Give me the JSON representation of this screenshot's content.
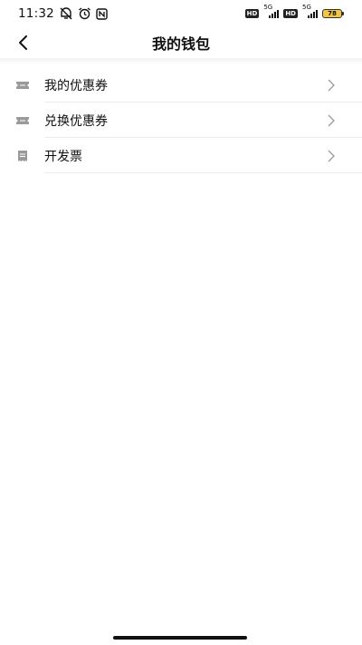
{
  "status_bar": {
    "time": "11:32",
    "network_1": "5G",
    "network_2": "5G",
    "hd_1": "HD",
    "hd_2": "HD",
    "battery": "78"
  },
  "header": {
    "title": "我的钱包"
  },
  "menu": {
    "items": [
      {
        "label": "我的优惠券",
        "icon": "ticket-icon"
      },
      {
        "label": "兑换优惠券",
        "icon": "ticket-icon"
      },
      {
        "label": "开发票",
        "icon": "invoice-icon"
      }
    ]
  },
  "colors": {
    "icon_gray": "#9a9a9a",
    "chevron_gray": "#9a9a9a",
    "divider": "#ececec",
    "battery_fill": "#f4c542"
  }
}
